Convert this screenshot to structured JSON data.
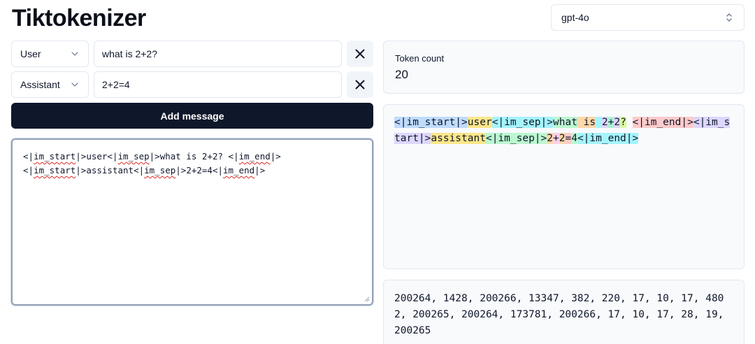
{
  "app": {
    "title": "Tiktokenizer"
  },
  "model_select": {
    "value": "gpt-4o",
    "icon": "chevron-up-down-icon"
  },
  "messages": [
    {
      "role": "User",
      "content": "what is 2+2?"
    },
    {
      "role": "Assistant",
      "content": "2+2=4"
    }
  ],
  "add_message_label": "Add message",
  "prompt": {
    "line1_a": "<|",
    "line1_b": "im_start",
    "line1_c": "|>user<|",
    "line1_d": "im_sep",
    "line1_e": "|>what is 2+2? <|",
    "line1_f": "im_end",
    "line1_g": "|>",
    "line2_a": "<|",
    "line2_b": "im_start",
    "line2_c": "|>assistant<|",
    "line2_d": "im_sep",
    "line2_e": "|>2+2=4<|",
    "line2_f": "im_end",
    "line2_g": "|>"
  },
  "token_count": {
    "label": "Token count",
    "value": "20"
  },
  "tokens": [
    "<|im_start|>",
    "user",
    "<|im_sep|>",
    "what",
    " is",
    " ",
    "2",
    "+",
    "2",
    "?",
    " ",
    "<|im_end|>",
    "<|im_start|>",
    "assistant",
    "<|im_sep|>",
    "2",
    "+",
    "2",
    "=",
    "4",
    "<|im_end|>"
  ],
  "token_ids": "200264, 1428, 200266, 13347, 382, 220, 17, 10, 17, 4802, 200265, 200264, 173781, 200266, 17, 10, 17, 28, 19, 200265"
}
